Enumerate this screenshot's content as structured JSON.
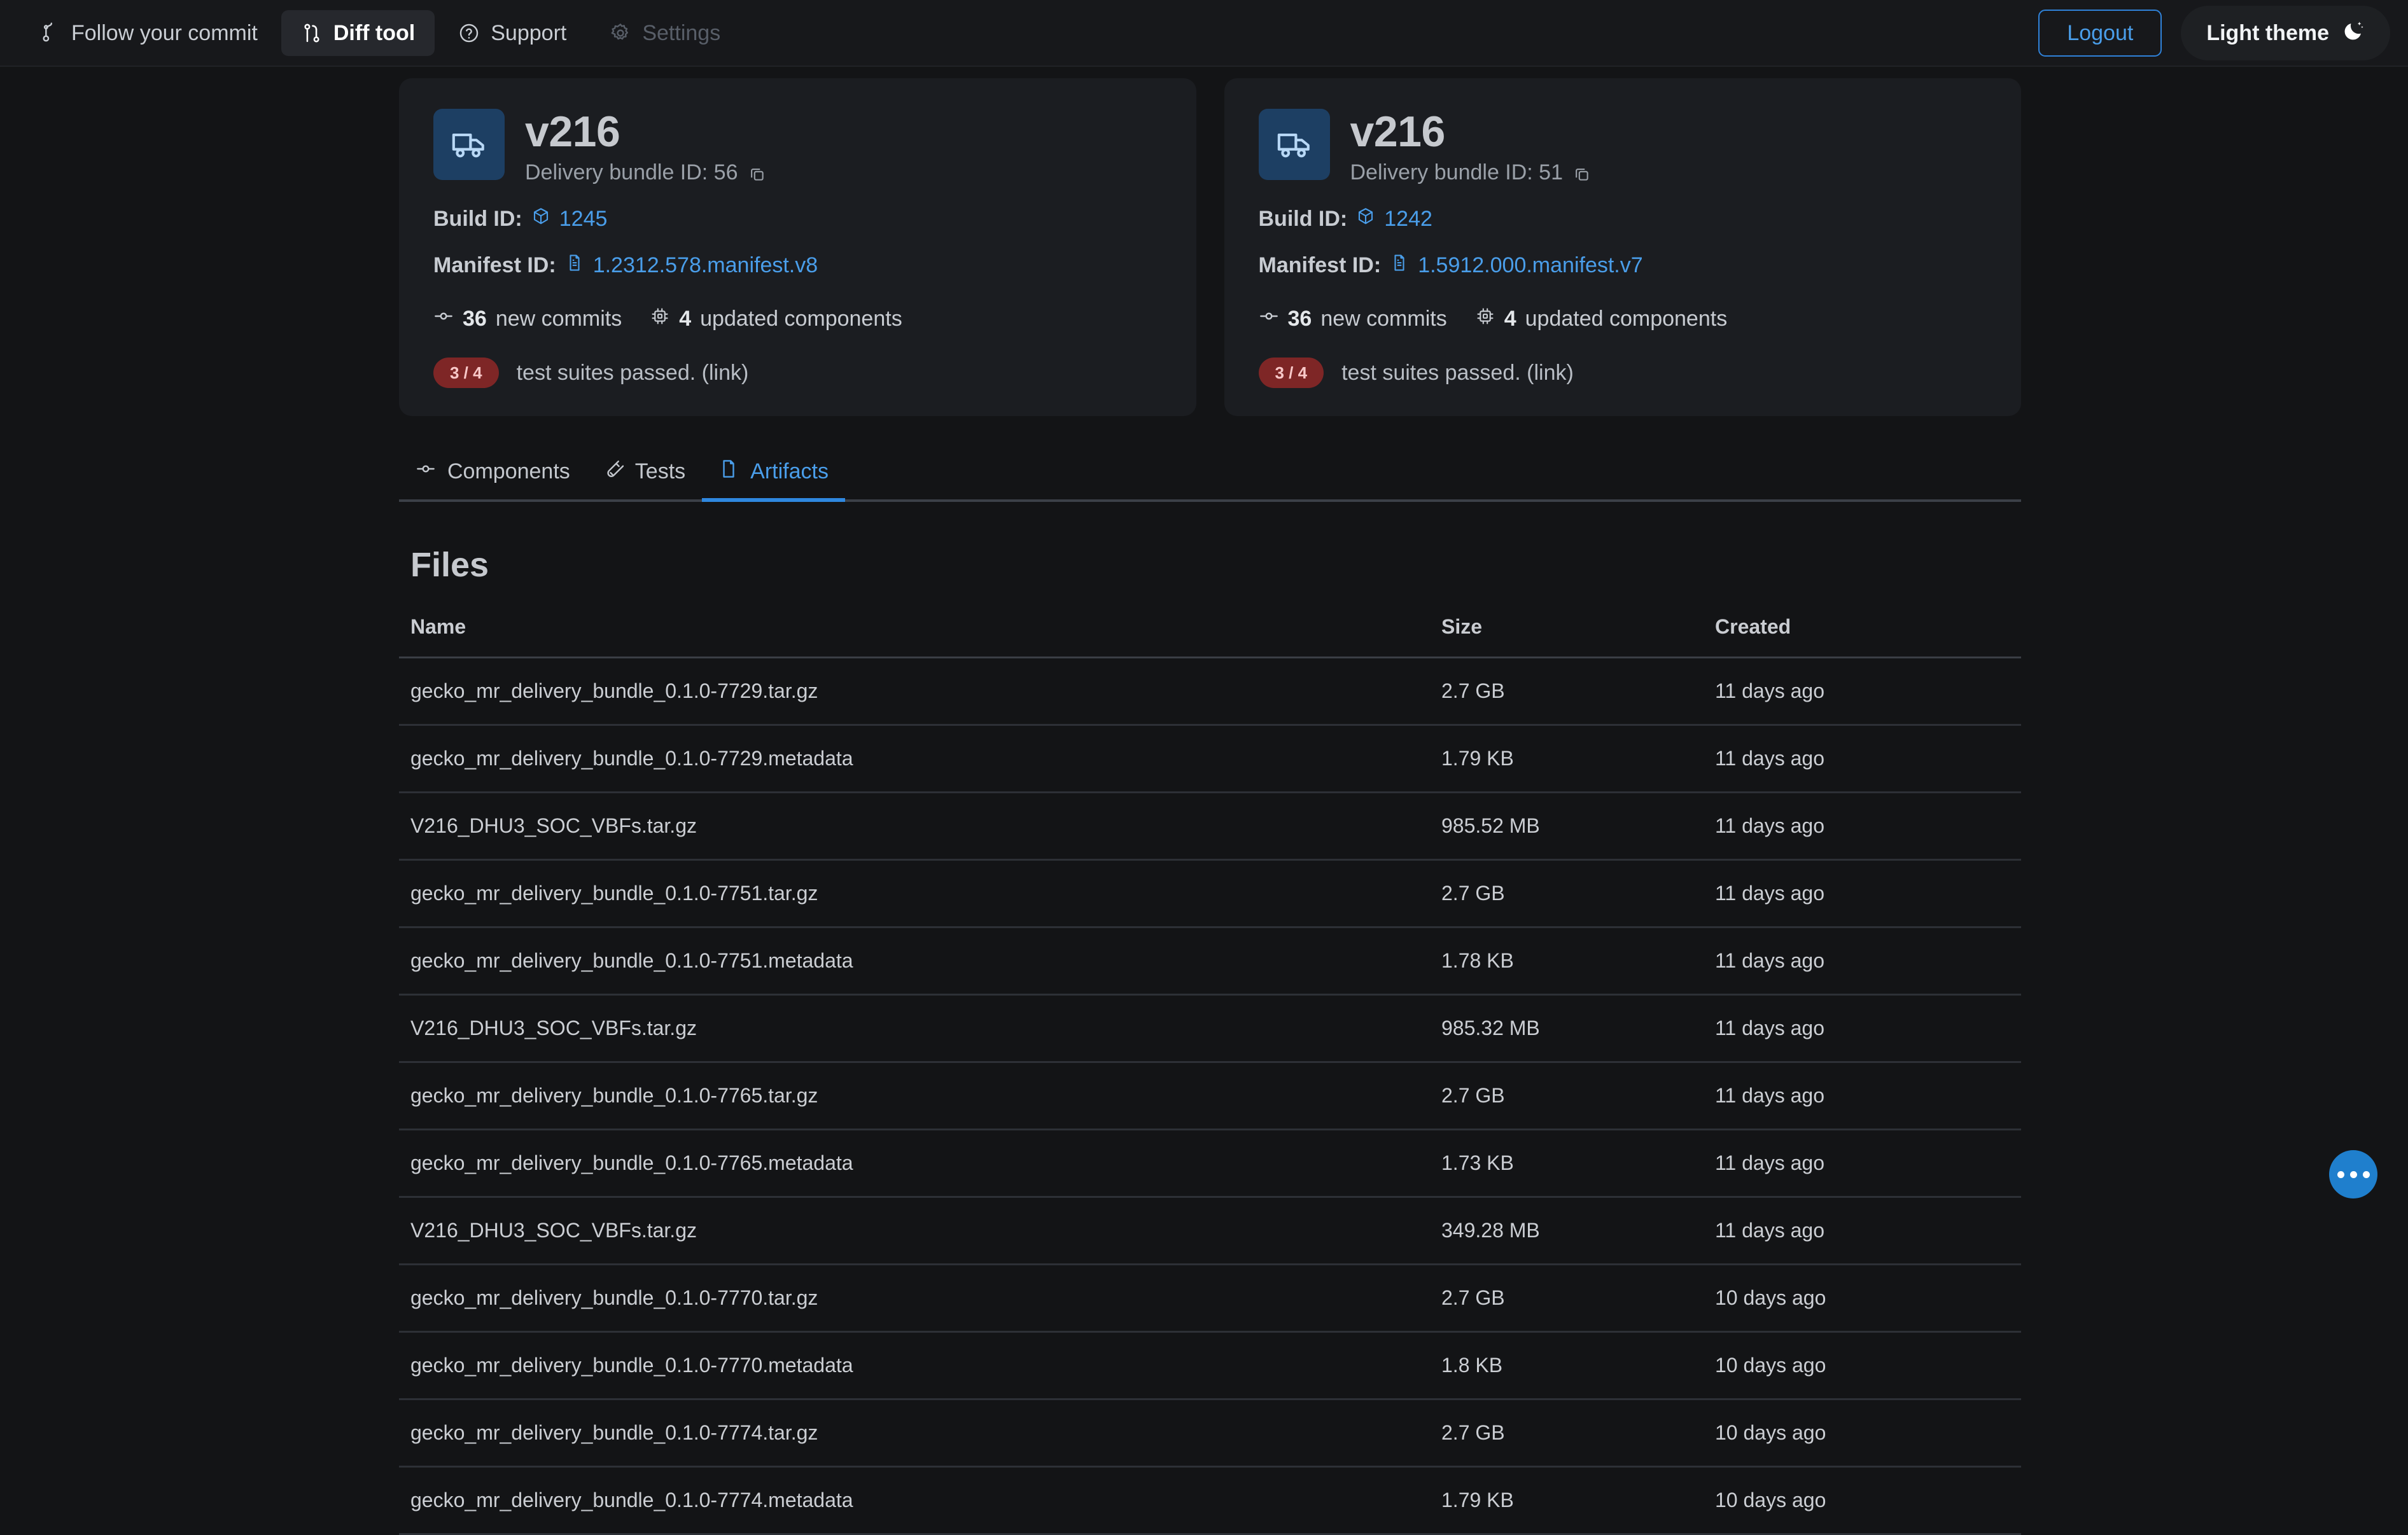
{
  "nav": {
    "items": [
      {
        "label": "Follow your commit",
        "icon": "git-branch-icon",
        "state": "normal"
      },
      {
        "label": "Diff tool",
        "icon": "git-compare-icon",
        "state": "active"
      },
      {
        "label": "Support",
        "icon": "question-circle-icon",
        "state": "normal"
      },
      {
        "label": "Settings",
        "icon": "gear-icon",
        "state": "disabled"
      }
    ],
    "logout_label": "Logout",
    "theme_label": "Light theme",
    "theme_icon": "moon-icon",
    "accent_color": "#4a9eea"
  },
  "cards": [
    {
      "title": "v216",
      "icon": "truck-icon",
      "bundle_label": "Delivery bundle ID: 56",
      "copy_icon": "copy-icon",
      "build_id_label": "Build ID:",
      "build_id_value": "1245",
      "build_id_icon": "package-icon",
      "manifest_label": "Manifest ID:",
      "manifest_value": "1.2312.578.manifest.v8",
      "manifest_icon": "file-icon",
      "commits_count": "36",
      "commits_label": "new commits",
      "commits_icon": "commit-icon",
      "components_count": "4",
      "components_label": "updated components",
      "components_icon": "cpu-icon",
      "test_badge": "3 / 4",
      "test_badge_color": "#7e2626",
      "test_text": "test suites passed. (link)"
    },
    {
      "title": "v216",
      "icon": "truck-icon",
      "bundle_label": "Delivery bundle ID: 51",
      "copy_icon": "copy-icon",
      "build_id_label": "Build ID:",
      "build_id_value": "1242",
      "build_id_icon": "package-icon",
      "manifest_label": "Manifest ID:",
      "manifest_value": "1.5912.000.manifest.v7",
      "manifest_icon": "file-icon",
      "commits_count": "36",
      "commits_label": "new commits",
      "commits_icon": "commit-icon",
      "components_count": "4",
      "components_label": "updated components",
      "components_icon": "cpu-icon",
      "test_badge": "3 / 4",
      "test_badge_color": "#7e2626",
      "test_text": "test suites passed. (link)"
    }
  ],
  "tabs": [
    {
      "label": "Components",
      "icon": "commit-icon",
      "active": false
    },
    {
      "label": "Tests",
      "icon": "test-tube-icon",
      "active": false
    },
    {
      "label": "Artifacts",
      "icon": "file-icon",
      "active": true
    }
  ],
  "files": {
    "heading": "Files",
    "columns": [
      "Name",
      "Size",
      "Created"
    ],
    "rows": [
      {
        "name": "gecko_mr_delivery_bundle_0.1.0-7729.tar.gz",
        "size": "2.7 GB",
        "created": "11 days ago"
      },
      {
        "name": "gecko_mr_delivery_bundle_0.1.0-7729.metadata",
        "size": "1.79 KB",
        "created": "11 days ago"
      },
      {
        "name": "V216_DHU3_SOC_VBFs.tar.gz",
        "size": "985.52 MB",
        "created": "11 days ago"
      },
      {
        "name": "gecko_mr_delivery_bundle_0.1.0-7751.tar.gz",
        "size": "2.7 GB",
        "created": "11 days ago"
      },
      {
        "name": "gecko_mr_delivery_bundle_0.1.0-7751.metadata",
        "size": "1.78 KB",
        "created": "11 days ago"
      },
      {
        "name": "V216_DHU3_SOC_VBFs.tar.gz",
        "size": "985.32 MB",
        "created": "11 days ago"
      },
      {
        "name": "gecko_mr_delivery_bundle_0.1.0-7765.tar.gz",
        "size": "2.7 GB",
        "created": "11 days ago"
      },
      {
        "name": "gecko_mr_delivery_bundle_0.1.0-7765.metadata",
        "size": "1.73 KB",
        "created": "11 days ago"
      },
      {
        "name": "V216_DHU3_SOC_VBFs.tar.gz",
        "size": "349.28 MB",
        "created": "11 days ago"
      },
      {
        "name": "gecko_mr_delivery_bundle_0.1.0-7770.tar.gz",
        "size": "2.7 GB",
        "created": "10 days ago"
      },
      {
        "name": "gecko_mr_delivery_bundle_0.1.0-7770.metadata",
        "size": "1.8 KB",
        "created": "10 days ago"
      },
      {
        "name": "gecko_mr_delivery_bundle_0.1.0-7774.tar.gz",
        "size": "2.7 GB",
        "created": "10 days ago"
      },
      {
        "name": "gecko_mr_delivery_bundle_0.1.0-7774.metadata",
        "size": "1.79 KB",
        "created": "10 days ago"
      }
    ]
  },
  "fab": {
    "icon": "ellipsis-icon",
    "color": "#1f7fcd"
  }
}
